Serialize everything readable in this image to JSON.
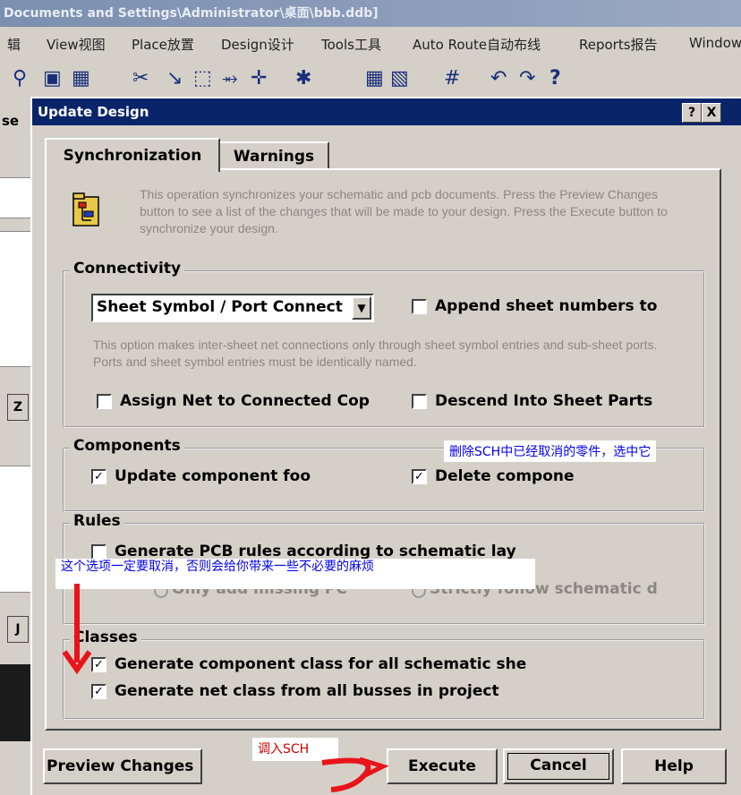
{
  "app": {
    "title": "Documents and Settings\\Administrator\\桌面\\bbb.ddb]",
    "menu": [
      "辑",
      "View视图",
      "Place放置",
      "Design设计",
      "Tools工具",
      "Auto Route自动布线",
      "Reports报告",
      "Window"
    ],
    "side_fragments": [
      "se",
      "Z",
      "J"
    ]
  },
  "dialog": {
    "title": "Update Design",
    "help_btn": "?",
    "close_btn": "X",
    "tabs": [
      "Synchronization",
      "Warnings"
    ],
    "intro": "This operation synchronizes your schematic and pcb documents.  Press the Preview Changes button to see a list of the changes that will be made to your design.  Press the Execute button to synchronize your design.",
    "connectivity": {
      "legend": "Connectivity",
      "select_value": "Sheet Symbol / Port Connect",
      "append_label": "Append sheet numbers to",
      "append_checked": false,
      "hint": "This option makes inter-sheet net connections only through sheet symbol entries and sub-sheet ports. Ports and sheet symbol entries must be identically named.",
      "assign_label": "Assign Net to Connected Cop",
      "assign_checked": false,
      "descend_label": "Descend Into Sheet Parts",
      "descend_checked": false
    },
    "components": {
      "legend": "Components",
      "update_label": "Update component foo",
      "update_checked": true,
      "delete_label": "Delete compone",
      "delete_checked": true
    },
    "rules": {
      "legend": "Rules",
      "generate_label": "Generate PCB rules according to schematic lay",
      "generate_checked": false,
      "radio1": "Only add missing PC",
      "radio2": "Strictly follow schematic d"
    },
    "classes": {
      "legend": "Classes",
      "component_class_label": "Generate component class for all schematic she",
      "component_class_checked": true,
      "net_class_label": "Generate net class from all busses in project",
      "net_class_checked": true
    },
    "buttons": {
      "preview": "Preview Changes",
      "execute": "Execute",
      "cancel": "Cancel",
      "help": "Help"
    }
  },
  "annotations": {
    "delete_note": "删除SCH中已经取消的零件，选中它",
    "rules_note": "这个选项一定要取消，否则会给你带来一些不必要的麻烦",
    "execute_note": "调入SCH"
  },
  "colors": {
    "title_bar": "#0a246a",
    "annotation_text": "#0000ee",
    "arrow": "#e8141a"
  }
}
